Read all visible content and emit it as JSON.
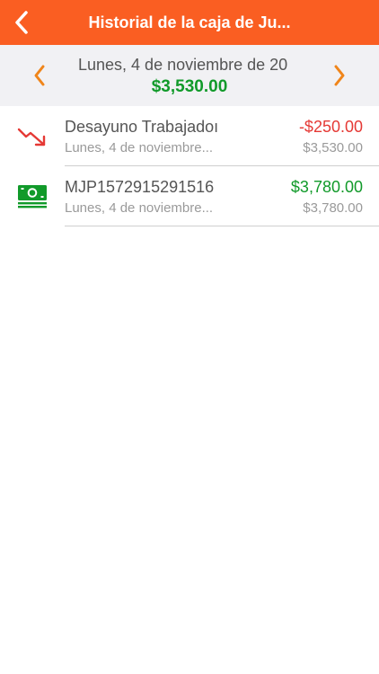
{
  "nav": {
    "title": "Historial de la caja de Ju...",
    "back_icon": "chevron-left-icon"
  },
  "date_bar": {
    "date": "Lunes, 4 de noviembre de 20",
    "total": "$3,530.00",
    "prev_icon": "chevron-left-icon",
    "next_icon": "chevron-right-icon"
  },
  "transactions": [
    {
      "icon": "trending-down-icon",
      "title": "Desayuno Trabajadoı",
      "date": "Lunes, 4 de noviembre...",
      "amount": "-$250.00",
      "balance": "$3,530.00",
      "amount_color": "#e53935"
    },
    {
      "icon": "cash-icon",
      "title": "MJP1572915291516",
      "date": "Lunes, 4 de noviembre...",
      "amount": "$3,780.00",
      "balance": "$3,780.00",
      "amount_color": "#119a2a"
    }
  ],
  "colors": {
    "brand": "#fa5e22",
    "accent": "#f0851a",
    "positive": "#119a2a",
    "negative": "#e53935"
  }
}
